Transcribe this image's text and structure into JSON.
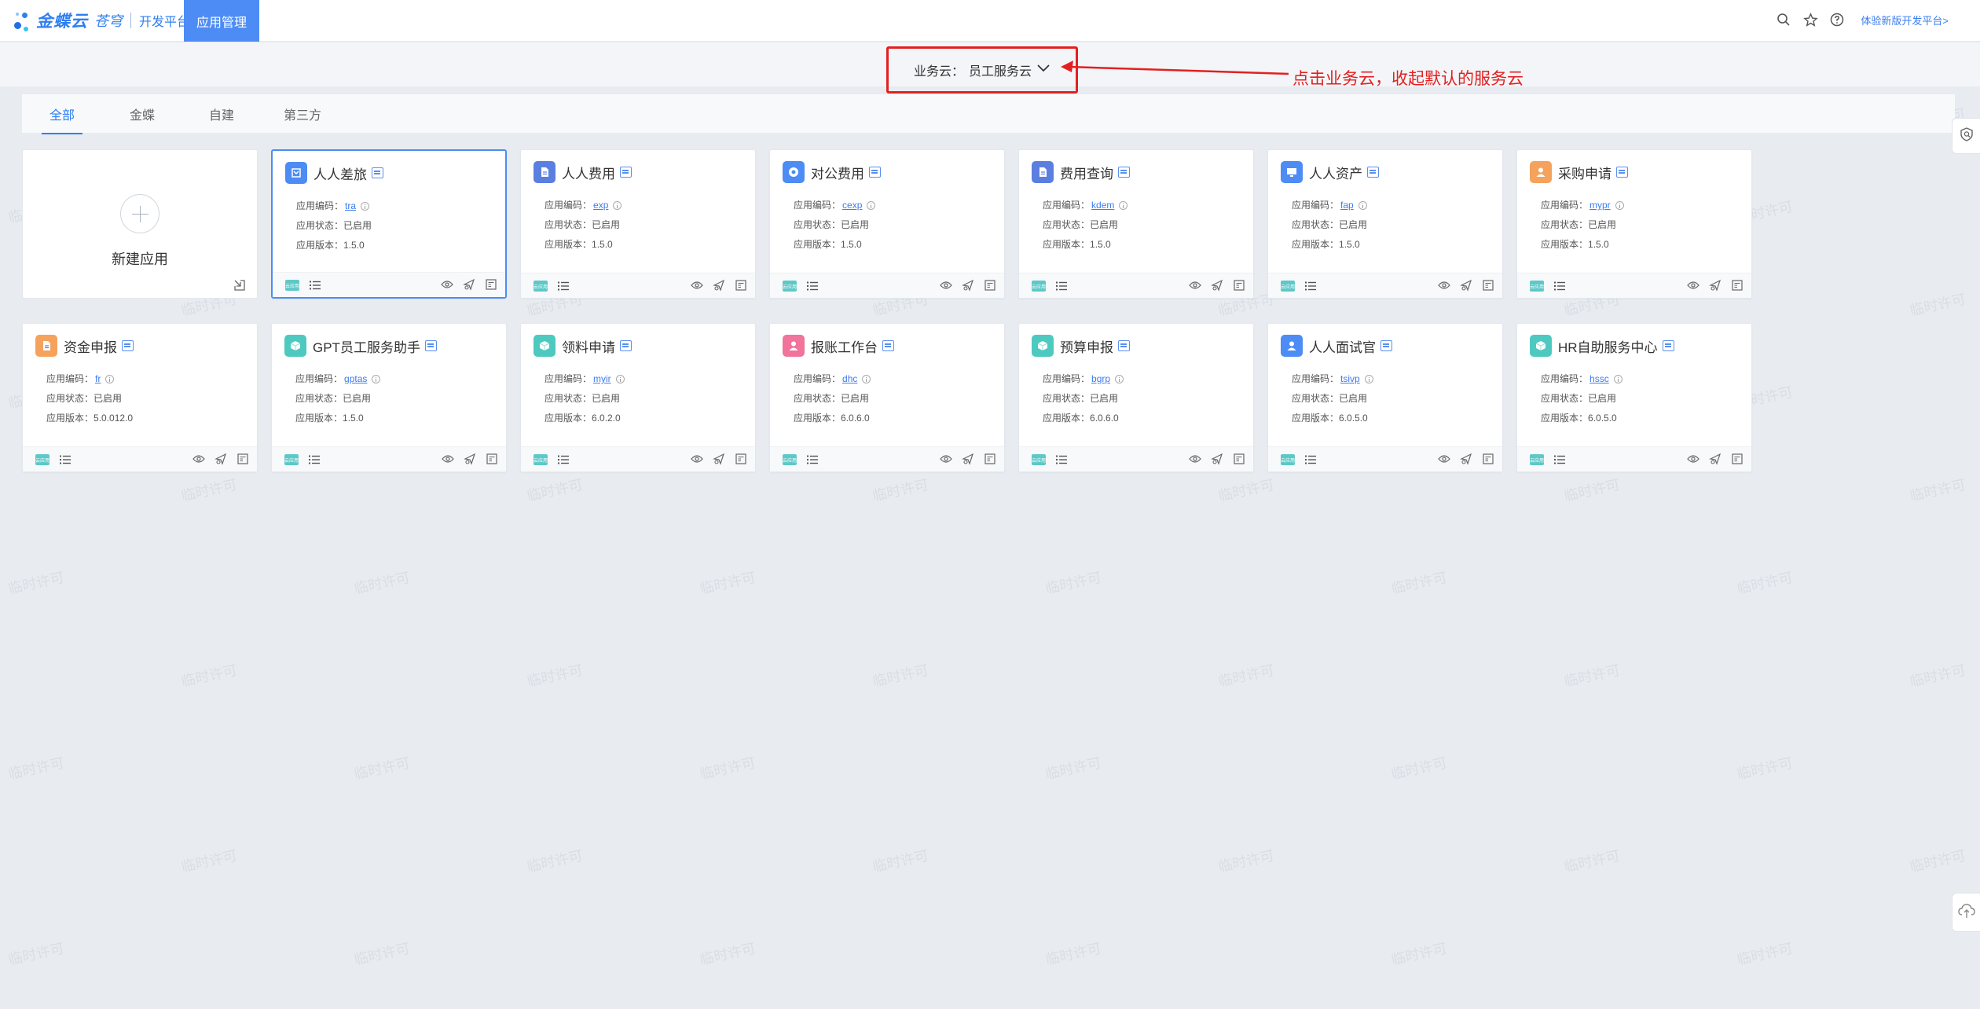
{
  "brand": {
    "logo_text": "金蝶云",
    "logo_sub": "苍穹",
    "platform": "开发平台"
  },
  "nav": {
    "active_tab": "应用管理"
  },
  "header_right": {
    "trial_link": "体验新版开发平台>"
  },
  "cloud_selector": {
    "label": "业务云：",
    "value": "员工服务云"
  },
  "annotation": {
    "text": "点击业务云，收起默认的服务云"
  },
  "tabs": [
    {
      "label": "全部",
      "active": true
    },
    {
      "label": "金蝶",
      "active": false
    },
    {
      "label": "自建",
      "active": false
    },
    {
      "label": "第三方",
      "active": false
    }
  ],
  "new_app": {
    "label": "新建应用"
  },
  "field_labels": {
    "code": "应用编码：",
    "status": "应用状态：",
    "version": "应用版本："
  },
  "cloud_tag": "云应用",
  "apps": [
    {
      "name": "人人差旅",
      "code": "tra",
      "status": "已启用",
      "version": "1.5.0",
      "icon_color": "#4d8cf5",
      "icon": "plane-icon"
    },
    {
      "name": "人人费用",
      "code": "exp",
      "status": "已启用",
      "version": "1.5.0",
      "icon_color": "#5b7fe0",
      "icon": "doc-icon"
    },
    {
      "name": "对公费用",
      "code": "cexp",
      "status": "已启用",
      "version": "1.5.0",
      "icon_color": "#4d8cf5",
      "icon": "gear-icon"
    },
    {
      "name": "费用查询",
      "code": "kdem",
      "status": "已启用",
      "version": "1.5.0",
      "icon_color": "#5b7fe0",
      "icon": "doc-icon"
    },
    {
      "name": "人人资产",
      "code": "fap",
      "status": "已启用",
      "version": "1.5.0",
      "icon_color": "#4d8cf5",
      "icon": "monitor-icon"
    },
    {
      "name": "采购申请",
      "code": "mypr",
      "status": "已启用",
      "version": "1.5.0",
      "icon_color": "#f5a25d",
      "icon": "person-icon"
    },
    {
      "name": "资金申报",
      "code": "fr",
      "status": "已启用",
      "version": "5.0.012.0",
      "icon_color": "#f5a25d",
      "icon": "doc-icon"
    },
    {
      "name": "GPT员工服务助手",
      "code": "gptas",
      "status": "已启用",
      "version": "1.5.0",
      "icon_color": "#4ec9c0",
      "icon": "box-icon"
    },
    {
      "name": "领料申请",
      "code": "myir",
      "status": "已启用",
      "version": "6.0.2.0",
      "icon_color": "#4ec9c0",
      "icon": "box-icon"
    },
    {
      "name": "报账工作台",
      "code": "dhc",
      "status": "已启用",
      "version": "6.0.6.0",
      "icon_color": "#f0749b",
      "icon": "person-icon"
    },
    {
      "name": "预算申报",
      "code": "bgrp",
      "status": "已启用",
      "version": "6.0.6.0",
      "icon_color": "#4ec9c0",
      "icon": "box-icon"
    },
    {
      "name": "人人面试官",
      "code": "tsivp",
      "status": "已启用",
      "version": "6.0.5.0",
      "icon_color": "#4d8cf5",
      "icon": "person-icon"
    },
    {
      "name": "HR自助服务中心",
      "code": "hssc",
      "status": "已启用",
      "version": "6.0.5.0",
      "icon_color": "#4ec9c0",
      "icon": "box-icon"
    }
  ],
  "watermark": "临时许可",
  "colors": {
    "accent": "#4d8cf5",
    "annotation_red": "#e32020",
    "background": "#e8ecf1"
  }
}
